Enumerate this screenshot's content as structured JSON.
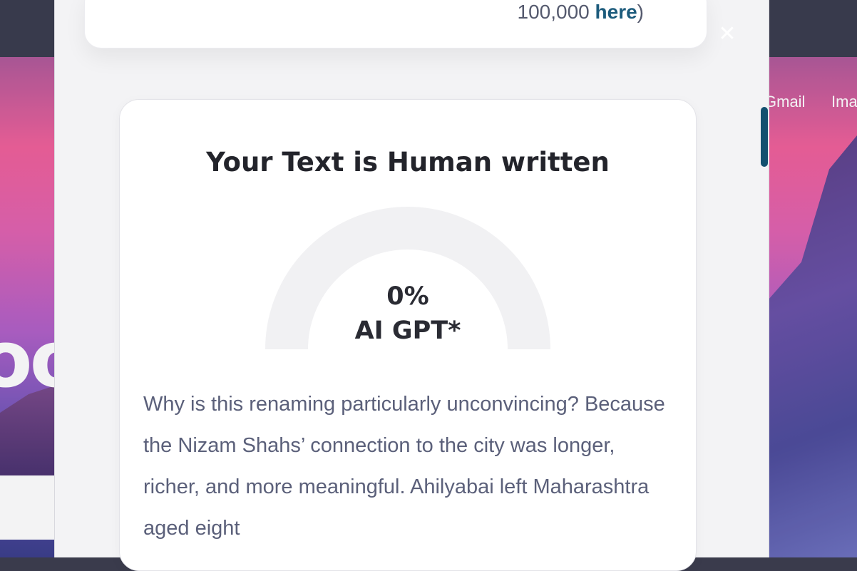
{
  "background": {
    "nav_gmail": "Gmail",
    "nav_images": "Images"
  },
  "modal": {
    "close_label": "✕",
    "top_card": {
      "prefix": "100,000 ",
      "link": "here",
      "suffix": ")"
    },
    "result": {
      "title": "Your Text is Human written",
      "percent": "0%",
      "caption": "AI GPT*",
      "ai_fraction": 0,
      "body": "Why is this renaming particularly unconvincing? Because the Nizam Shahs’ connection to the city was longer, richer, and more meaningful. Ahilyabai left Maharashtra aged eight"
    }
  },
  "colors": {
    "accent": "#1c5b7c",
    "gauge_track": "#f1f1f3"
  }
}
